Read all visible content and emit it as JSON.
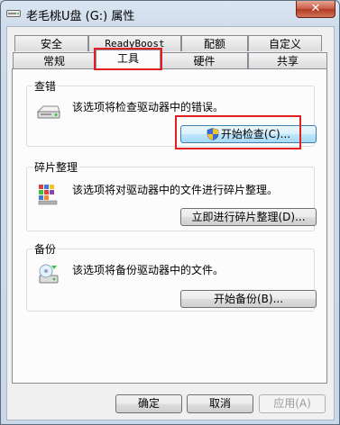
{
  "window": {
    "title": "老毛桃U盘 (G:) 属性",
    "close_glyph": "✕"
  },
  "tabs": {
    "row1": [
      {
        "label": "安全"
      },
      {
        "label": "ReadyBoost"
      },
      {
        "label": "配额"
      },
      {
        "label": "自定义"
      }
    ],
    "row2": [
      {
        "label": "常规"
      },
      {
        "label": "工具",
        "active": true
      },
      {
        "label": "硬件"
      },
      {
        "label": "共享"
      }
    ]
  },
  "groups": {
    "error_check": {
      "title": "查错",
      "description": "该选项将检查驱动器中的错误。",
      "button_label": "开始检查(C)...",
      "icon": "drive-check-icon"
    },
    "defrag": {
      "title": "碎片整理",
      "description": "该选项将对驱动器中的文件进行碎片整理。",
      "button_label": "立即进行碎片整理(D)...",
      "icon": "defrag-icon"
    },
    "backup": {
      "title": "备份",
      "description": "该选项将备份驱动器中的文件。",
      "button_label": "开始备份(B)...",
      "icon": "backup-icon"
    }
  },
  "footer": {
    "ok_label": "确定",
    "cancel_label": "取消",
    "apply_label": "应用(A)"
  },
  "colors": {
    "highlight": "#e02020",
    "accent": "#3c7fb1"
  }
}
